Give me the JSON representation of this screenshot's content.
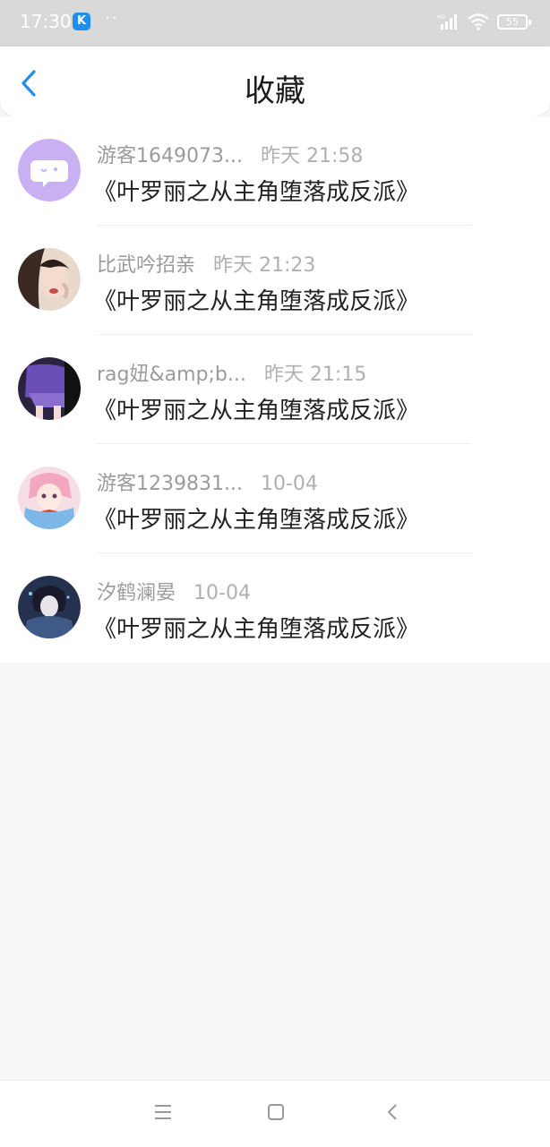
{
  "status_bar": {
    "time": "17:30",
    "app_icon_letter": "K",
    "dots": "··",
    "battery": "55"
  },
  "header": {
    "title": "收藏"
  },
  "items": [
    {
      "name": "游客1649073...",
      "time": "昨天 21:58",
      "title": "《叶罗丽之从主角堕落成反派》"
    },
    {
      "name": "比武吟招亲",
      "time": "昨天 21:23",
      "title": "《叶罗丽之从主角堕落成反派》"
    },
    {
      "name": "rag妞&amp;b...",
      "time": "昨天 21:15",
      "title": "《叶罗丽之从主角堕落成反派》"
    },
    {
      "name": "游客1239831...",
      "time": "10-04",
      "title": "《叶罗丽之从主角堕落成反派》"
    },
    {
      "name": "汐鹤澜晏",
      "time": "10-04",
      "title": "《叶罗丽之从主角堕落成反派》"
    }
  ],
  "colors": {
    "accent": "#1f8ef1",
    "avatar_1": "#c9b0f2"
  }
}
